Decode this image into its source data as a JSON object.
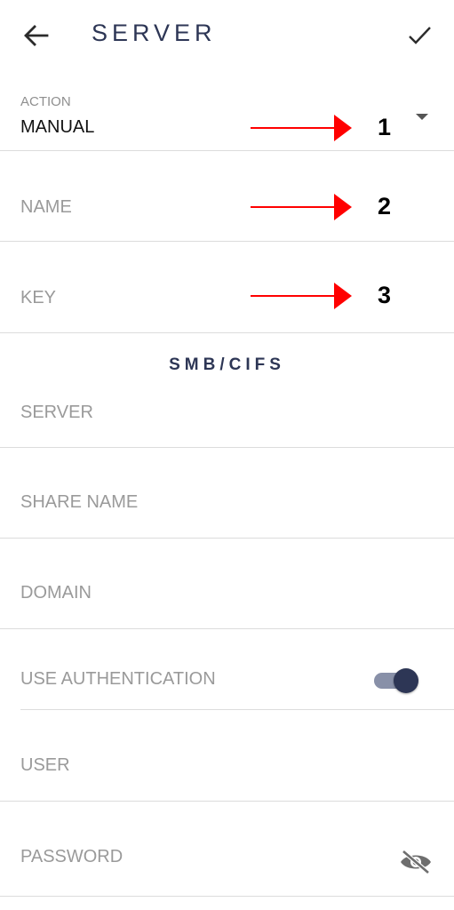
{
  "header": {
    "title": "SERVER",
    "back_icon": "arrow-left-icon",
    "confirm_icon": "check-icon"
  },
  "action": {
    "label": "ACTION",
    "value": "MANUAL",
    "dropdown_icon": "caret-down-icon"
  },
  "fields": {
    "name_placeholder": "NAME",
    "key_placeholder": "KEY"
  },
  "callouts": [
    "1",
    "2",
    "3"
  ],
  "smb": {
    "section_title": "SMB/CIFS",
    "server_placeholder": "SERVER",
    "share_name_placeholder": "SHARE NAME",
    "domain_placeholder": "DOMAIN",
    "use_authentication_label": "USE AUTHENTICATION",
    "use_authentication_on": true,
    "user_placeholder": "USER",
    "password_placeholder": "PASSWORD",
    "password_visibility_icon": "eye-off-icon"
  },
  "colors": {
    "accent": "#2d3655",
    "arrow": "#ff0000",
    "toggle_track": "#8890a8"
  }
}
